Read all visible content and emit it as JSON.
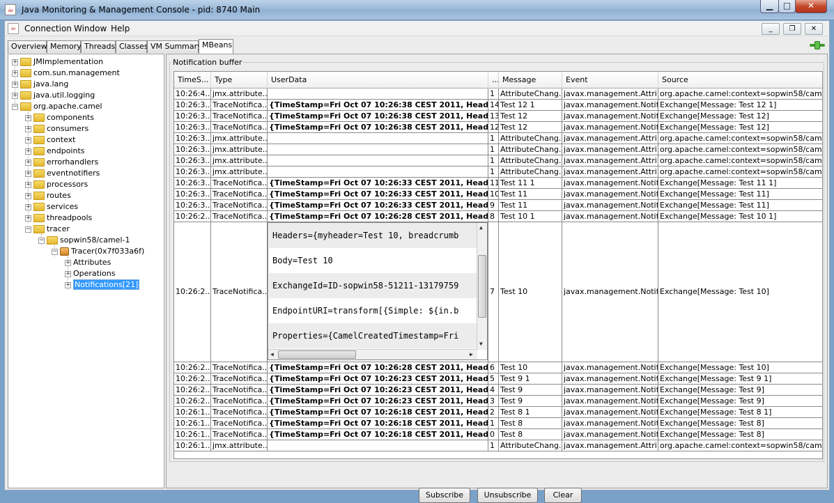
{
  "window": {
    "title": "Java Monitoring & Management Console - pid: 8740 Main",
    "min": "▁",
    "max": "□",
    "close": "✕"
  },
  "menu": {
    "items": [
      "Connection",
      "Window",
      "Help"
    ]
  },
  "mdi": {
    "min": "_",
    "restore": "❐",
    "close": "✕"
  },
  "tabs": [
    "Overview",
    "Memory",
    "Threads",
    "Classes",
    "VM Summary",
    "MBeans"
  ],
  "tree": {
    "roots": [
      "JMImplementation",
      "com.sun.management",
      "java.lang",
      "java.util.logging",
      "org.apache.camel"
    ],
    "camel_children": [
      "components",
      "consumers",
      "context",
      "endpoints",
      "errorhandlers",
      "eventnotifiers",
      "processors",
      "routes",
      "services",
      "threadpools",
      "tracer"
    ],
    "tracer_child": "sopwin58/camel-1",
    "bean": "Tracer(0x7f033a6f)",
    "bean_children": [
      "Attributes",
      "Operations",
      "Notifications[21]"
    ]
  },
  "panel": {
    "group_title": "Notification buffer"
  },
  "table": {
    "headers": [
      "TimeS...",
      "Type",
      "UserData",
      "...",
      "Message",
      "Event",
      "Source"
    ],
    "rows": [
      [
        "10:26:4...",
        "jmx.attribute...",
        "",
        "1",
        "AttributeChang...",
        "javax.management.Attri...",
        "org.apache.camel:context=sopwin58/camel-1..."
      ],
      [
        "10:26:3...",
        "TraceNotifica...",
        "{TimeStamp=Fri Oct 07 10:26:38 CEST 2011, Headers...",
        "14",
        "Test 12 1",
        "javax.management.Notifi...",
        "Exchange[Message: Test 12 1]"
      ],
      [
        "10:26:3...",
        "TraceNotifica...",
        "{TimeStamp=Fri Oct 07 10:26:38 CEST 2011, Headers...",
        "13",
        "Test 12",
        "javax.management.Notifi...",
        "Exchange[Message: Test 12]"
      ],
      [
        "10:26:3...",
        "TraceNotifica...",
        "{TimeStamp=Fri Oct 07 10:26:38 CEST 2011, Headers...",
        "12",
        "Test 12",
        "javax.management.Notifi...",
        "Exchange[Message: Test 12]"
      ],
      [
        "10:26:3...",
        "jmx.attribute...",
        "",
        "1",
        "AttributeChang...",
        "javax.management.Attri...",
        "org.apache.camel:context=sopwin58/camel-1..."
      ],
      [
        "10:26:3...",
        "jmx.attribute...",
        "",
        "1",
        "AttributeChang...",
        "javax.management.Attri...",
        "org.apache.camel:context=sopwin58/camel-1..."
      ],
      [
        "10:26:3...",
        "jmx.attribute...",
        "",
        "1",
        "AttributeChang...",
        "javax.management.Attri...",
        "org.apache.camel:context=sopwin58/camel-1..."
      ],
      [
        "10:26:3...",
        "jmx.attribute...",
        "",
        "1",
        "AttributeChang...",
        "javax.management.Attri...",
        "org.apache.camel:context=sopwin58/camel-1..."
      ],
      [
        "10:26:3...",
        "TraceNotifica...",
        "{TimeStamp=Fri Oct 07 10:26:33 CEST 2011, Headers...",
        "11",
        "Test 11 1",
        "javax.management.Notifi...",
        "Exchange[Message: Test 11 1]"
      ],
      [
        "10:26:3...",
        "TraceNotifica...",
        "{TimeStamp=Fri Oct 07 10:26:33 CEST 2011, Headers...",
        "10",
        "Test 11",
        "javax.management.Notifi...",
        "Exchange[Message: Test 11]"
      ],
      [
        "10:26:3...",
        "TraceNotifica...",
        "{TimeStamp=Fri Oct 07 10:26:33 CEST 2011, Headers...",
        "9",
        "Test 11",
        "javax.management.Notifi...",
        "Exchange[Message: Test 11]"
      ],
      [
        "10:26:2...",
        "TraceNotifica...",
        "{TimeStamp=Fri Oct 07 10:26:28 CEST 2011, Headers...",
        "8",
        "Test 10 1",
        "javax.management.Notifi...",
        "Exchange[Message: Test 10 1]"
      ]
    ],
    "expanded_row": {
      "time": "10:26:2...",
      "type": "TraceNotifica...",
      "seq": "7",
      "message": "Test 10",
      "event": "javax.management.Notifi...",
      "source": "Exchange[Message: Test 10]",
      "detail_lines": [
        "Headers={myheader=Test 10, breadcrumb",
        "Body=Test 10",
        "ExchangeId=ID-sopwin58-51211-13179759",
        "EndpointURI=transform[{Simple: ${in.b",
        "Properties={CamelCreatedTimestamp=Fri"
      ]
    },
    "rows_after": [
      [
        "10:26:2...",
        "TraceNotifica...",
        "{TimeStamp=Fri Oct 07 10:26:28 CEST 2011, Headers...",
        "6",
        "Test 10",
        "javax.management.Notifi...",
        "Exchange[Message: Test 10]"
      ],
      [
        "10:26:2...",
        "TraceNotifica...",
        "{TimeStamp=Fri Oct 07 10:26:23 CEST 2011, Headers...",
        "5",
        "Test 9 1",
        "javax.management.Notifi...",
        "Exchange[Message: Test 9 1]"
      ],
      [
        "10:26:2...",
        "TraceNotifica...",
        "{TimeStamp=Fri Oct 07 10:26:23 CEST 2011, Headers...",
        "4",
        "Test 9",
        "javax.management.Notifi...",
        "Exchange[Message: Test 9]"
      ],
      [
        "10:26:2...",
        "TraceNotifica...",
        "{TimeStamp=Fri Oct 07 10:26:23 CEST 2011, Headers...",
        "3",
        "Test 9",
        "javax.management.Notifi...",
        "Exchange[Message: Test 9]"
      ],
      [
        "10:26:1...",
        "TraceNotifica...",
        "{TimeStamp=Fri Oct 07 10:26:18 CEST 2011, Headers...",
        "2",
        "Test 8 1",
        "javax.management.Notifi...",
        "Exchange[Message: Test 8 1]"
      ],
      [
        "10:26:1...",
        "TraceNotifica...",
        "{TimeStamp=Fri Oct 07 10:26:18 CEST 2011, Headers...",
        "1",
        "Test 8",
        "javax.management.Notifi...",
        "Exchange[Message: Test 8]"
      ],
      [
        "10:26:1...",
        "TraceNotifica...",
        "{TimeStamp=Fri Oct 07 10:26:18 CEST 2011, Headers...",
        "0",
        "Test 8",
        "javax.management.Notifi...",
        "Exchange[Message: Test 8]"
      ],
      [
        "10:26:1...",
        "jmx.attribute...",
        "",
        "1",
        "AttributeChang...",
        "javax.management.Attri...",
        "org.apache.camel:context=sopwin58/camel-1..."
      ]
    ]
  },
  "buttons": {
    "subscribe": "Subscribe",
    "unsubscribe": "Unsubscribe",
    "clear": "Clear"
  },
  "icons": {
    "folder": "folder-icon",
    "bean": "mbean-icon",
    "connection": "connected-plug-icon"
  },
  "colors": {
    "selection": "#3399ff",
    "titlebar": "#9dbad9",
    "close": "#c44a2e"
  }
}
